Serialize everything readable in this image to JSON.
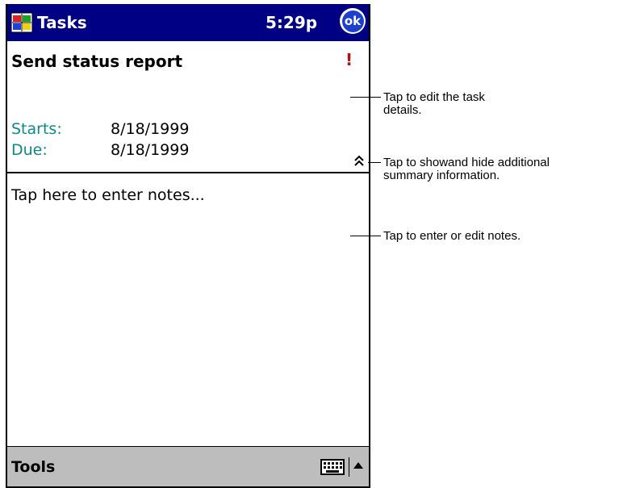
{
  "titlebar": {
    "start_icon": "windows-flag-start-icon",
    "title": "Tasks",
    "clock": "5:29p",
    "ok_label": "ok"
  },
  "task": {
    "title": "Send status report",
    "priority_icon": "high-priority-exclamation-icon",
    "priority_glyph": "!",
    "starts_label": "Starts:",
    "starts_value": "8/18/1999",
    "due_label": "Due:",
    "due_value": "8/18/1999",
    "expand_icon": "double-chevron-up-icon"
  },
  "notes": {
    "placeholder": "Tap here to enter notes..."
  },
  "menubar": {
    "tools_label": "Tools",
    "keyboard_icon": "keyboard-icon",
    "sip_arrow_icon": "up-arrow-icon"
  },
  "callouts": {
    "edit_details": "Tap to edit the task\ndetails.",
    "show_hide": "Tap to showand hide additional\nsummary information.",
    "edit_notes": "Tap to enter or edit notes."
  },
  "colors": {
    "titlebar_bg": "#000084",
    "field_label": "#0c8a8a",
    "priority": "#b01010",
    "menubar_bg": "#bdbdbd"
  }
}
